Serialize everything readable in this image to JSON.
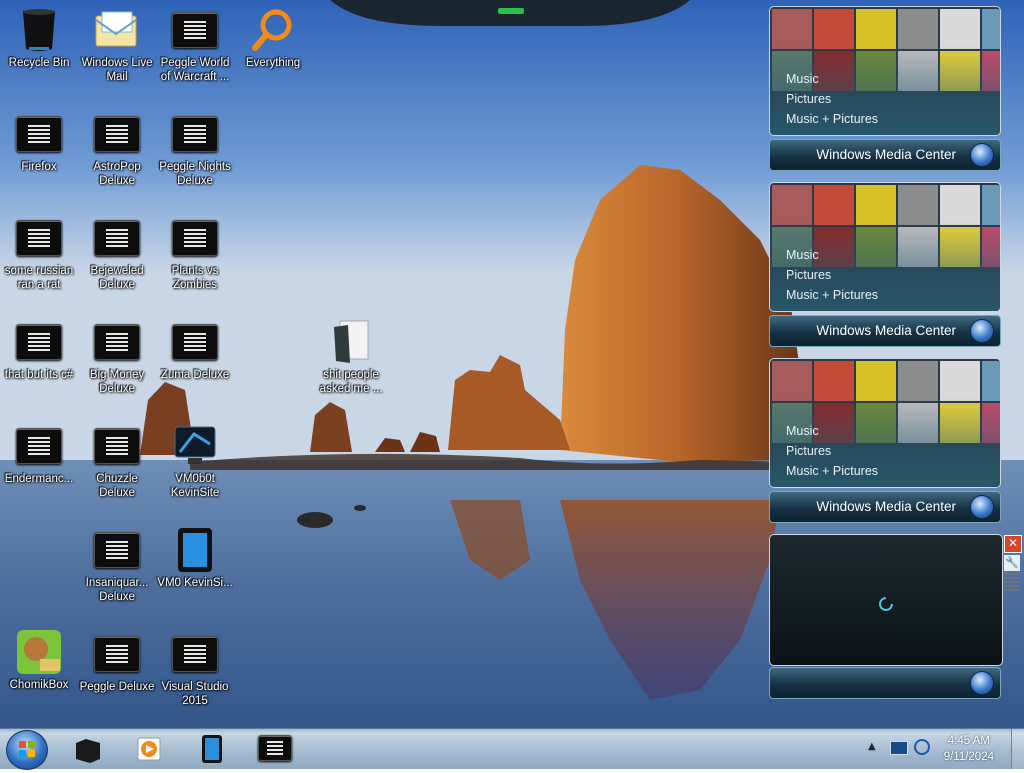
{
  "desktop": {
    "icons": [
      {
        "label": "Recycle Bin"
      },
      {
        "label": "Windows Live Mail"
      },
      {
        "label": "Peggle World of Warcraft ..."
      },
      {
        "label": "Everything"
      },
      {
        "label": "Firefox"
      },
      {
        "label": "AstroPop Deluxe"
      },
      {
        "label": "Peggle Nights Deluxe"
      },
      {
        "label": "some russian ran a rat"
      },
      {
        "label": "Bejeweled Deluxe"
      },
      {
        "label": "Plants vs Zombies"
      },
      {
        "label": "that but its c#"
      },
      {
        "label": "Big Money Deluxe"
      },
      {
        "label": "Zuma Deluxe"
      },
      {
        "label": "shit people asked me ..."
      },
      {
        "label": "Endermanc..."
      },
      {
        "label": "Chuzzle Deluxe"
      },
      {
        "label": "VM0b0t KevinSite"
      },
      {
        "label": "Insaniquar... Deluxe"
      },
      {
        "label": "VM0 KevinSi..."
      },
      {
        "label": "ChomikBox"
      },
      {
        "label": "Peggle Deluxe"
      },
      {
        "label": "Visual Studio 2015"
      }
    ]
  },
  "gadgets": {
    "menu": [
      "Music",
      "Pictures",
      "Music + Pictures"
    ],
    "brand_light": "Windows",
    "brand_bold": "Media Center"
  },
  "clock": {
    "time": "4:45 AM",
    "date": "9/11/2024"
  },
  "colors": {
    "sky_top": "#2f63b8",
    "sea": "#2c4f86",
    "rock": "#b8652a",
    "gadget_bar": "#163244"
  }
}
